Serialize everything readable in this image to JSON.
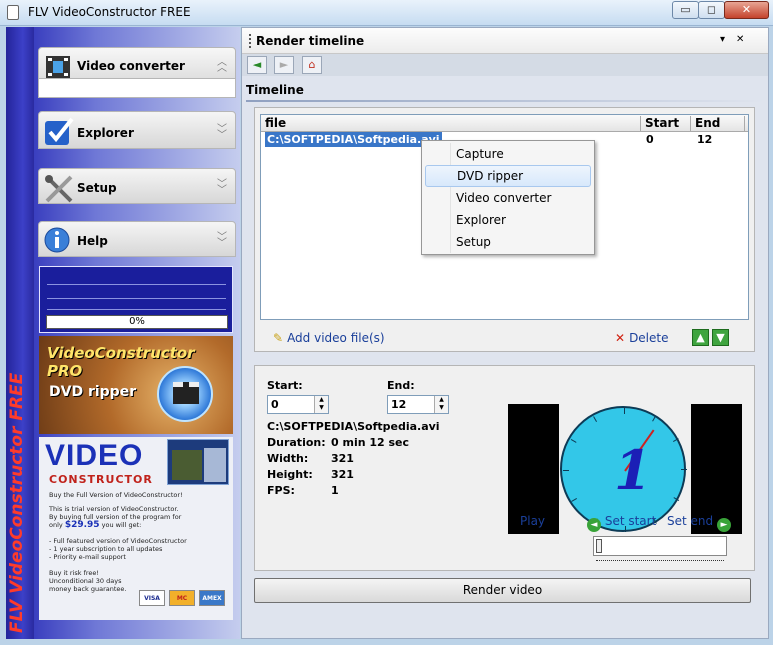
{
  "window": {
    "title": "FLV VideoConstructor FREE",
    "minimize": "▭",
    "maximize": "◻",
    "close": "✕"
  },
  "brand": {
    "vertical_text": "FLV VideoConstructor FREE"
  },
  "nav": [
    {
      "label": "Video converter",
      "icon": "film-icon"
    },
    {
      "label": "Explorer",
      "icon": "checkmark-icon"
    },
    {
      "label": "Setup",
      "icon": "tools-icon"
    },
    {
      "label": "Help",
      "icon": "info-icon"
    }
  ],
  "progress": {
    "value_text": "0%",
    "value": 0
  },
  "promo_pro": {
    "title": "VideoConstructor PRO",
    "subtitle": "DVD ripper"
  },
  "promo": {
    "title": "VIDEO",
    "subtitle": "CONSTRUCTOR",
    "line1": "Buy the Full Version of VideoConstructor!",
    "line2": "This is trial version of VideoConstructor.",
    "line3": "By buying full version of the program for",
    "line4_prefix": "only ",
    "price": "$29.95",
    "line4_suffix": " you will get:",
    "bullet1": "- Full featured version of VideoConstructor",
    "bullet2": "- 1 year subscription to all updates",
    "bullet3": "- Priority e-mail support",
    "line5": "Buy it risk free!",
    "line6": "Unconditional 30 days",
    "line7": "money back guarantee.",
    "cards": [
      "VISA",
      "MC",
      "AMEX"
    ]
  },
  "panel": {
    "title": "Render timeline",
    "dropdown": "▾",
    "close": "✕"
  },
  "toolbar": {
    "back": "◄",
    "forward": "►",
    "home": "⌂"
  },
  "timeline": {
    "section_title": "Timeline",
    "columns": [
      "file",
      "Start",
      "End"
    ],
    "rows": [
      {
        "file": "C:\\SOFTPEDIA\\Softpedia.avi",
        "start": "0",
        "end": "12"
      }
    ],
    "add_label": "Add video file(s)",
    "delete_label": "Delete",
    "up": "▲",
    "down": "▼"
  },
  "context_menu": {
    "items": [
      "Capture",
      "DVD ripper",
      "Video converter",
      "Explorer",
      "Setup"
    ],
    "highlighted": "DVD ripper"
  },
  "details": {
    "start_label": "Start:",
    "start_value": "0",
    "end_label": "End:",
    "end_value": "12",
    "filename": "C:\\SOFTPEDIA\\Softpedia.avi",
    "duration_label": "Duration:",
    "duration_value": "0 min 12 sec",
    "width_label": "Width:",
    "width_value": "321",
    "height_label": "Height:",
    "height_value": "321",
    "fps_label": "FPS:",
    "fps_value": "1"
  },
  "preview": {
    "frame_text": "1",
    "play_label": "Play",
    "set_start_label": "Set start",
    "set_end_label": "Set end"
  },
  "render_button": "Render video",
  "colors": {
    "brand_red": "#ff3b2a",
    "selection": "#3976c8",
    "link": "#1a3f9a"
  }
}
